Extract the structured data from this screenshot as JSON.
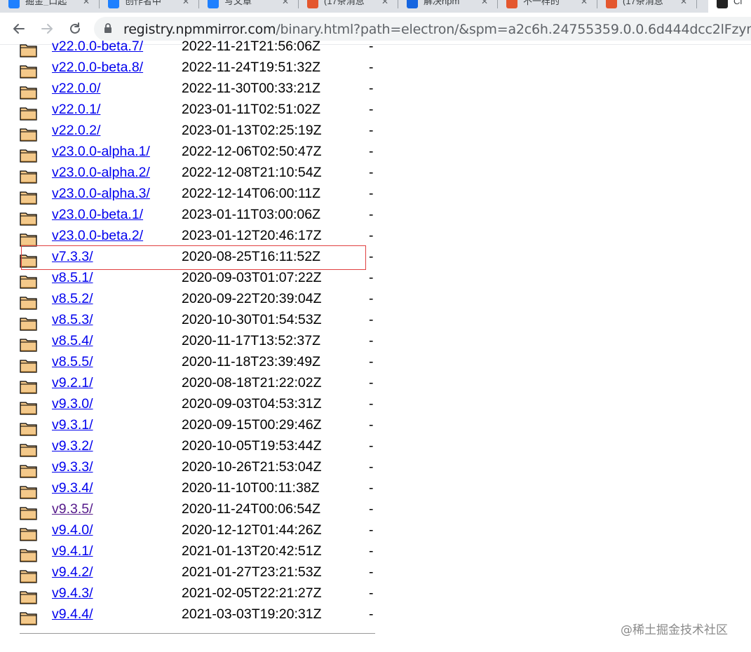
{
  "tabs": [
    {
      "title": "掘金_口起",
      "favicon_color": "#1e80ff"
    },
    {
      "title": "创作者中",
      "favicon_color": "#1e80ff"
    },
    {
      "title": "写文章",
      "favicon_color": "#1e80ff"
    },
    {
      "title": "(17条消息",
      "favicon_color": "#e4572e"
    },
    {
      "title": "解决npm",
      "favicon_color": "#1565e0"
    },
    {
      "title": "不一样的",
      "favicon_color": "#e4572e"
    },
    {
      "title": "(17条消息",
      "favicon_color": "#e4572e"
    },
    {
      "title": "Cl",
      "favicon_color": "#222222"
    }
  ],
  "address": {
    "host": "registry.npmmirror.com",
    "path": "/binary.html?path=electron/&spm=a2c6h.24755359.0.0.6d444dcc2lFzym"
  },
  "icons": {
    "back": "back-arrow-icon",
    "forward": "forward-arrow-icon",
    "reload": "reload-icon",
    "lock": "lock-icon",
    "folder": "folder-icon"
  },
  "colors": {
    "link": "#0000ee",
    "visited": "#551a8b",
    "highlight_border": "#e04040",
    "folder_fill": "#f4c98a"
  },
  "entries": [
    {
      "name": "v22.0.0-beta.7/",
      "date": "2022-11-21T21:56:06Z",
      "size": "-"
    },
    {
      "name": "v22.0.0-beta.8/",
      "date": "2022-11-24T19:51:32Z",
      "size": "-"
    },
    {
      "name": "v22.0.0/",
      "date": "2022-11-30T00:33:21Z",
      "size": "-"
    },
    {
      "name": "v22.0.1/",
      "date": "2023-01-11T02:51:02Z",
      "size": "-"
    },
    {
      "name": "v22.0.2/",
      "date": "2023-01-13T02:25:19Z",
      "size": "-"
    },
    {
      "name": "v23.0.0-alpha.1/",
      "date": "2022-12-06T02:50:47Z",
      "size": "-"
    },
    {
      "name": "v23.0.0-alpha.2/",
      "date": "2022-12-08T21:10:54Z",
      "size": "-"
    },
    {
      "name": "v23.0.0-alpha.3/",
      "date": "2022-12-14T06:00:11Z",
      "size": "-"
    },
    {
      "name": "v23.0.0-beta.1/",
      "date": "2023-01-11T03:00:06Z",
      "size": "-"
    },
    {
      "name": "v23.0.0-beta.2/",
      "date": "2023-01-12T20:46:17Z",
      "size": "-"
    },
    {
      "name": "v7.3.3/",
      "date": "2020-08-25T16:11:52Z",
      "size": "-",
      "highlighted": true
    },
    {
      "name": "v8.5.1/",
      "date": "2020-09-03T01:07:22Z",
      "size": "-"
    },
    {
      "name": "v8.5.2/",
      "date": "2020-09-22T20:39:04Z",
      "size": "-"
    },
    {
      "name": "v8.5.3/",
      "date": "2020-10-30T01:54:53Z",
      "size": "-"
    },
    {
      "name": "v8.5.4/",
      "date": "2020-11-17T13:52:37Z",
      "size": "-"
    },
    {
      "name": "v8.5.5/",
      "date": "2020-11-18T23:39:49Z",
      "size": "-"
    },
    {
      "name": "v9.2.1/",
      "date": "2020-08-18T21:22:02Z",
      "size": "-"
    },
    {
      "name": "v9.3.0/",
      "date": "2020-09-03T04:53:31Z",
      "size": "-"
    },
    {
      "name": "v9.3.1/",
      "date": "2020-09-15T00:29:46Z",
      "size": "-"
    },
    {
      "name": "v9.3.2/",
      "date": "2020-10-05T19:53:44Z",
      "size": "-"
    },
    {
      "name": "v9.3.3/",
      "date": "2020-10-26T21:53:04Z",
      "size": "-"
    },
    {
      "name": "v9.3.4/",
      "date": "2020-11-10T00:11:38Z",
      "size": "-"
    },
    {
      "name": "v9.3.5/",
      "date": "2020-11-24T00:06:54Z",
      "size": "-",
      "visited": true
    },
    {
      "name": "v9.4.0/",
      "date": "2020-12-12T01:44:26Z",
      "size": "-"
    },
    {
      "name": "v9.4.1/",
      "date": "2021-01-13T20:42:51Z",
      "size": "-"
    },
    {
      "name": "v9.4.2/",
      "date": "2021-01-27T23:21:53Z",
      "size": "-"
    },
    {
      "name": "v9.4.3/",
      "date": "2021-02-05T22:21:27Z",
      "size": "-"
    },
    {
      "name": "v9.4.4/",
      "date": "2021-03-03T19:20:31Z",
      "size": "-"
    }
  ],
  "watermark": "@稀土掘金技术社区"
}
